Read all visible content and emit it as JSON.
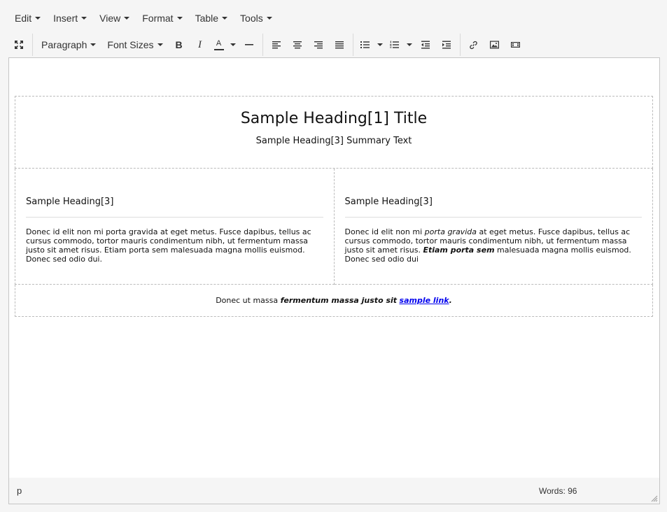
{
  "menubar": {
    "items": [
      "Edit",
      "Insert",
      "View",
      "Format",
      "Table",
      "Tools"
    ]
  },
  "toolbar": {
    "block_format": "Paragraph",
    "font_sizes": "Font Sizes",
    "icons": [
      "fullscreen-icon",
      "bold-icon",
      "italic-icon",
      "text-color-icon",
      "horizontal-rule-icon",
      "align-left-icon",
      "align-center-icon",
      "align-right-icon",
      "align-justify-icon",
      "bullet-list-icon",
      "numbered-list-icon",
      "outdent-icon",
      "indent-icon",
      "link-icon",
      "image-icon",
      "media-icon"
    ],
    "bold_glyph": "B",
    "italic_glyph": "I",
    "text_color_glyph": "A"
  },
  "content": {
    "title": "Sample Heading[1] Title",
    "summary": "Sample Heading[3] Summary Text",
    "left": {
      "heading": "Sample Heading[3]",
      "body": "Donec id elit non mi porta gravida at eget metus. Fusce dapibus, tellus ac cursus commodo, tortor mauris condimentum nibh, ut fermentum massa justo sit amet risus. Etiam porta sem malesuada magna mollis euismod. Donec sed odio dui."
    },
    "right": {
      "heading": "Sample Heading[3]",
      "body_1": "Donec id elit non mi ",
      "body_italic": "porta gravida",
      "body_2": " at eget metus. Fusce dapibus, tellus ac cursus commodo, tortor mauris condimentum nibh, ut fermentum massa justo sit amet risus. ",
      "body_bold_italic": "Etiam porta sem",
      "body_3": " malesuada magna mollis euismod. Donec sed odio dui"
    },
    "footer": {
      "text": "Donec ut massa ",
      "emphasis": "fermentum massa justo sit",
      "link": "sample link",
      "end": "."
    }
  },
  "statusbar": {
    "path": "p",
    "words": "Words: 96"
  }
}
